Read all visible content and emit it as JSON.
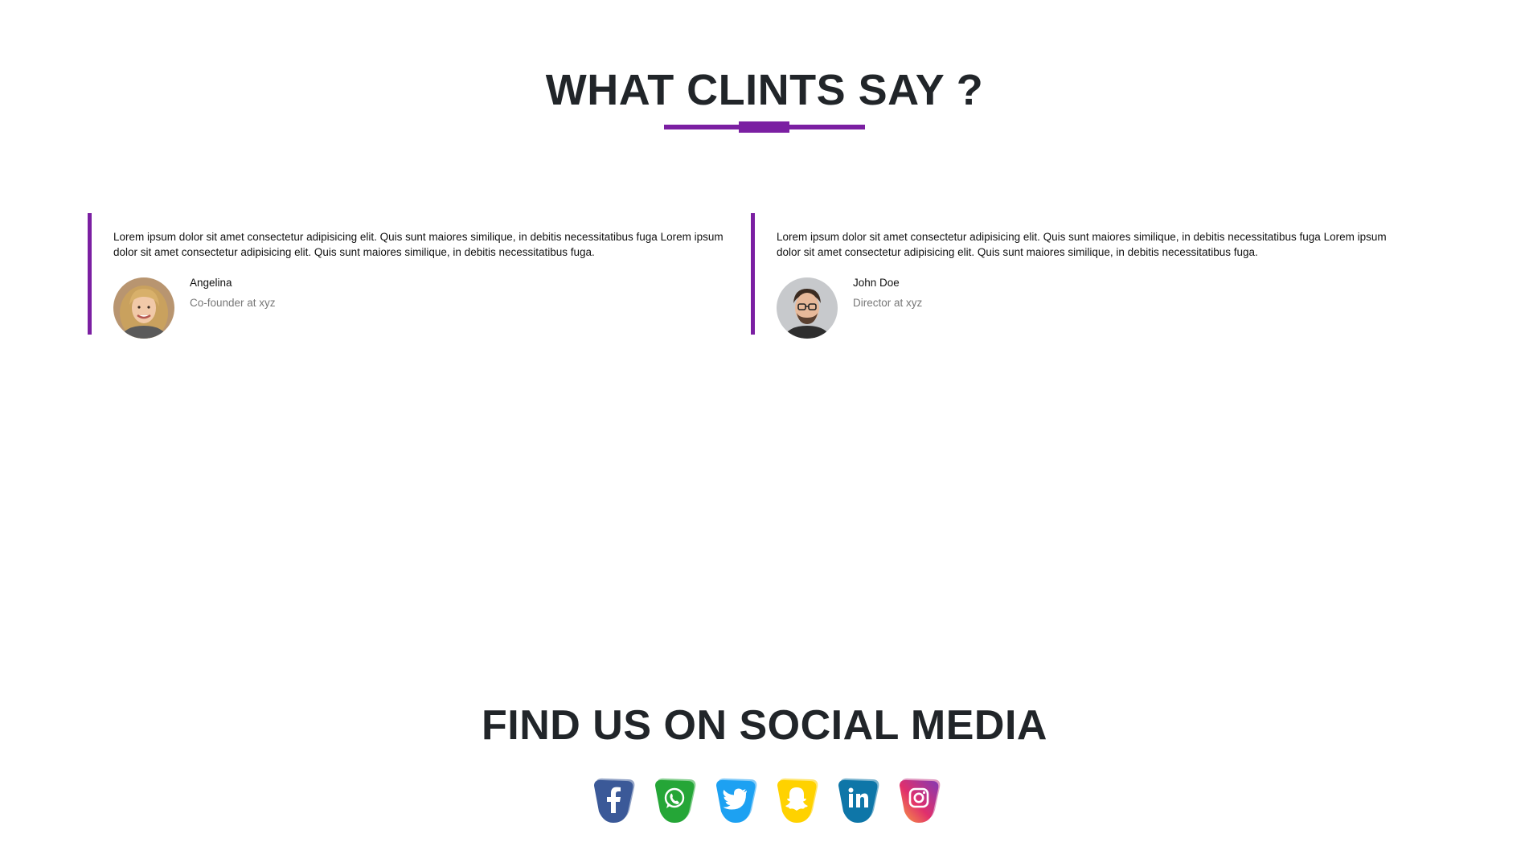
{
  "testimonials": {
    "title": "WHAT CLINTS SAY ?",
    "items": [
      {
        "quote": "Lorem ipsum dolor sit amet consectetur adipisicing elit. Quis sunt maiores similique, in debitis necessitatibus fuga Lorem ipsum dolor sit amet consectetur adipisicing elit. Quis sunt maiores similique, in debitis necessitatibus fuga.",
        "name": "Angelina",
        "role": "Co-founder at xyz"
      },
      {
        "quote": "Lorem ipsum dolor sit amet consectetur adipisicing elit. Quis sunt maiores similique, in debitis necessitatibus fuga Lorem ipsum dolor sit amet consectetur adipisicing elit. Quis sunt maiores similique, in debitis necessitatibus fuga.",
        "name": "John Doe",
        "role": "Director at xyz"
      }
    ]
  },
  "social": {
    "title": "FIND US ON SOCIAL MEDIA",
    "icons": [
      {
        "icon": "facebook-icon",
        "color": "#3b5998"
      },
      {
        "icon": "whatsapp-icon",
        "color": "#25a637"
      },
      {
        "icon": "twitter-icon",
        "color": "#1da1f2"
      },
      {
        "icon": "snapchat-icon",
        "color": "#ffd200"
      },
      {
        "icon": "linkedin-icon",
        "color": "#0e76a8"
      },
      {
        "icon": "instagram-icon",
        "color": "#d6249f"
      }
    ]
  },
  "colors": {
    "accent": "#7b1fa2"
  }
}
